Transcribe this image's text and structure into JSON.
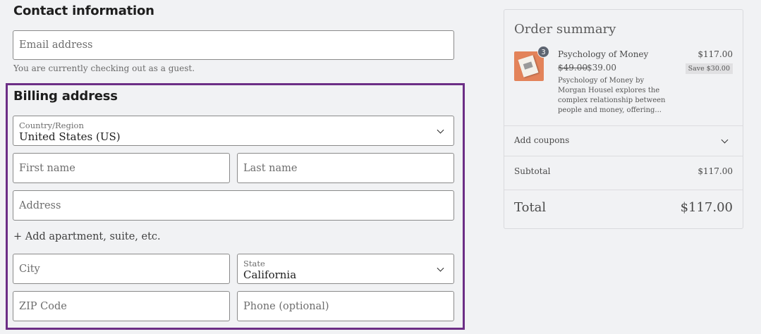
{
  "contact": {
    "title": "Contact information",
    "email_placeholder": "Email address",
    "guest_note": "You are currently checking out as a guest."
  },
  "billing": {
    "title": "Billing address",
    "country_label": "Country/Region",
    "country_value": "United States (US)",
    "first_name_placeholder": "First name",
    "last_name_placeholder": "Last name",
    "address_placeholder": "Address",
    "add_apartment": "+ Add apartment, suite, etc.",
    "city_placeholder": "City",
    "state_label": "State",
    "state_value": "California",
    "zip_placeholder": "ZIP Code",
    "phone_placeholder": "Phone (optional)",
    "highlight_color": "#6c2e86"
  },
  "summary": {
    "title": "Order summary",
    "item": {
      "quantity": "3",
      "name": "Psychology of Money",
      "original_price": "$49.00",
      "sale_price": "$39.00",
      "description": "Psychology of Money by Morgan Housel explores the complex relationship between people and money, offering...",
      "line_total": "$117.00",
      "savings": "Save $30.00"
    },
    "coupons_label": "Add coupons",
    "subtotal_label": "Subtotal",
    "subtotal_value": "$117.00",
    "total_label": "Total",
    "total_value": "$117.00"
  }
}
